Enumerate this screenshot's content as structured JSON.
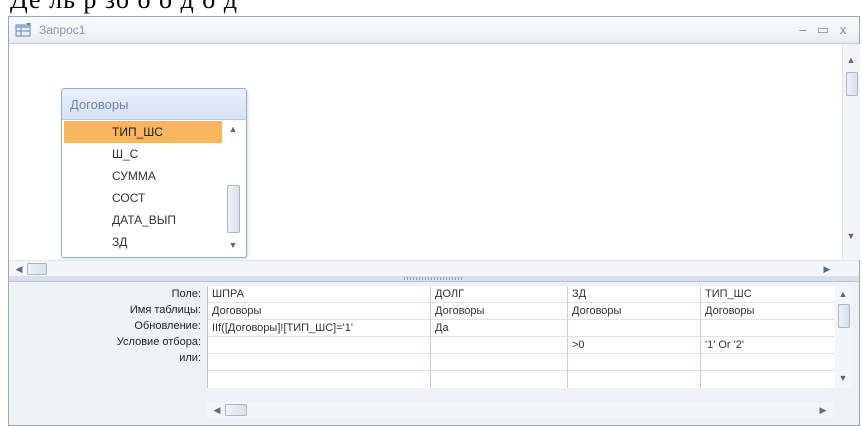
{
  "banner": {
    "text": "Де  ль   р   зо  о  о  д    о  д"
  },
  "window": {
    "title": "Запрос1",
    "minimize_glyph": "–",
    "restore_glyph": "▭",
    "close_glyph": "x"
  },
  "table": {
    "name": "Договоры",
    "fields": [
      "ТИП_ШС",
      "Ш_С",
      "СУММА",
      "СОСТ",
      "ДАТА_ВЫП",
      "ЗД"
    ],
    "selected_field": "ТИП_ШС"
  },
  "grid": {
    "row_labels": [
      "Поле:",
      "Имя таблицы:",
      "Обновление:",
      "Условие отбора:",
      "или:"
    ],
    "columns": [
      {
        "field": "ШПРА",
        "table": "Договоры",
        "update": "IIf([Договоры]![ТИП_ШС]='1'",
        "criteria": "",
        "or": ""
      },
      {
        "field": "ДОЛГ",
        "table": "Договоры",
        "update": "Да",
        "criteria": "",
        "or": ""
      },
      {
        "field": "ЗД",
        "table": "Договоры",
        "update": "",
        "criteria": ">0",
        "or": ""
      },
      {
        "field": "ТИП_ШС",
        "table": "Договоры",
        "update": "",
        "criteria": "'1' Or '2'",
        "or": ""
      }
    ]
  },
  "icons": {
    "title_icon": "query-icon",
    "scroll_up": "▲",
    "scroll_down": "▼",
    "scroll_left": "◀",
    "scroll_right": "▶"
  },
  "colors": {
    "selected_field": "#f9b55f",
    "table_header": "#d6e3f4",
    "lower_pane": "#eef2f7"
  }
}
